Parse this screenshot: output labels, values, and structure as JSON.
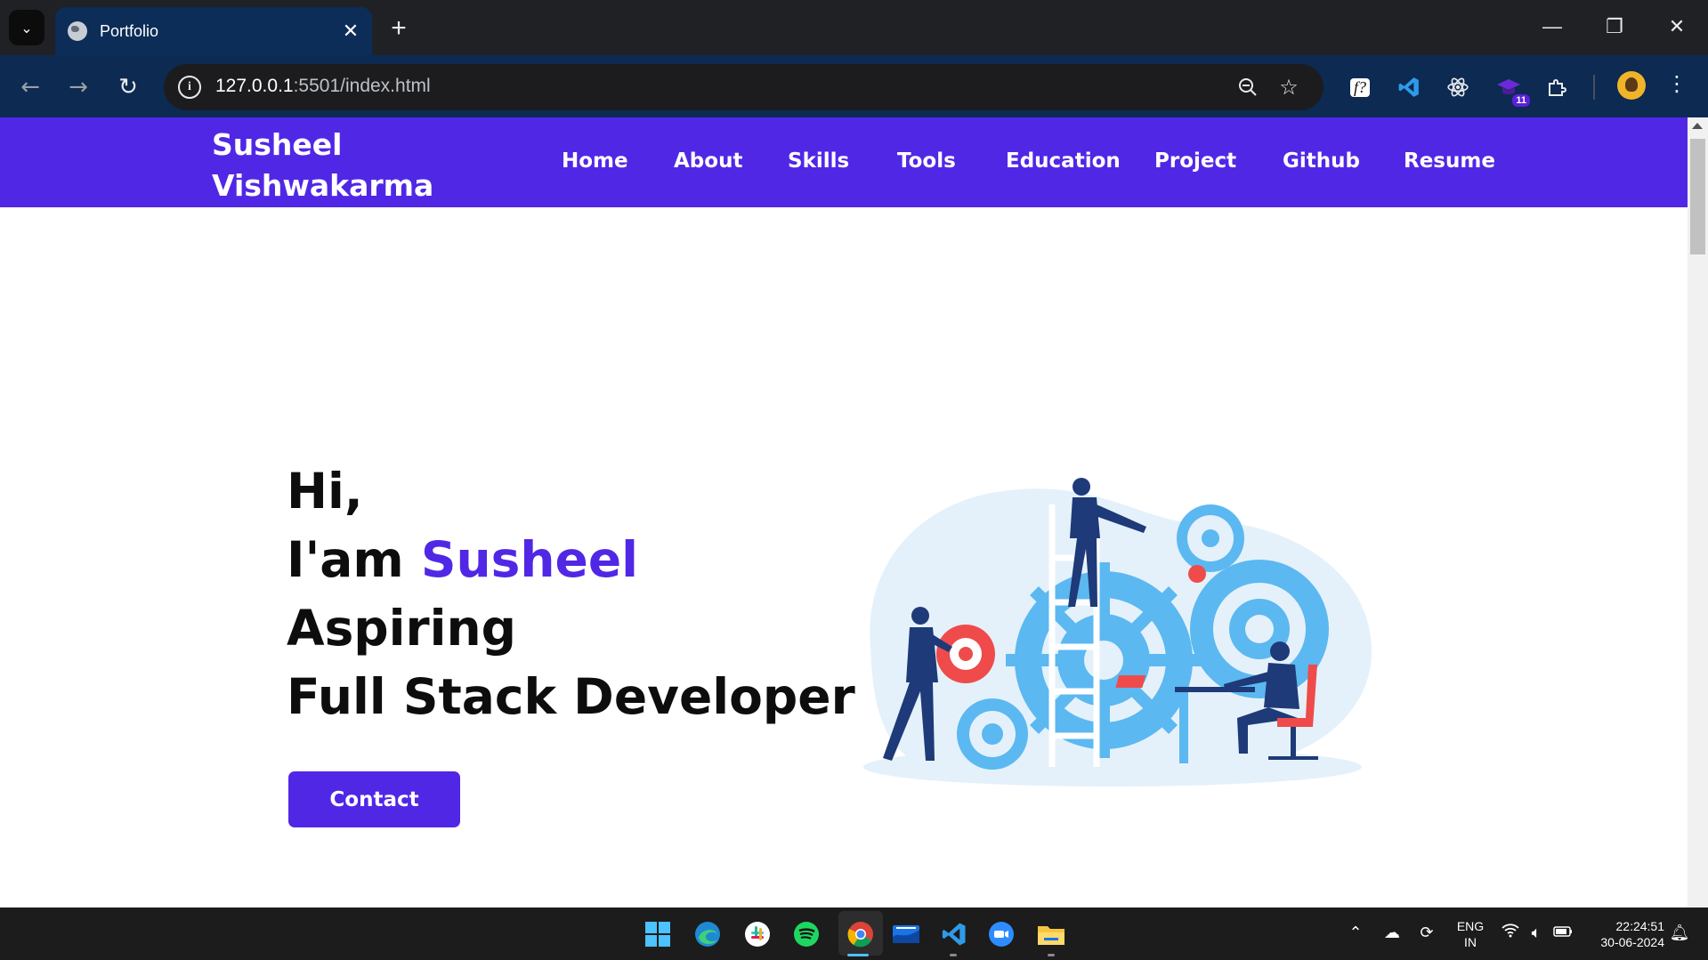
{
  "browser": {
    "tab_title": "Portfolio",
    "tab_close": "✕",
    "new_tab": "+",
    "url_host": "127.0.0.1",
    "url_rest": ":5501/index.html",
    "extension_badge": "11",
    "window_controls": {
      "minimize": "—",
      "restore": "❐",
      "close": "✕"
    }
  },
  "site": {
    "brand_line1": "Susheel",
    "brand_line2": "Vishwakarma",
    "accent_color": "#5127e6",
    "menu": [
      "Home",
      "About",
      "Skills",
      "Tools",
      "Education",
      "Project",
      "Github",
      "Resume"
    ]
  },
  "hero": {
    "line1": "Hi,",
    "line2_prefix": "I'am ",
    "line2_name": "Susheel",
    "line3": "Aspiring",
    "line4": "Full Stack Developer",
    "contact_label": "Contact"
  },
  "taskbar": {
    "lang_line1": "ENG",
    "lang_line2": "IN",
    "time": "22:24:51",
    "date": "30-06-2024",
    "apps": [
      "windows-start",
      "edge",
      "slack",
      "spotify",
      "chrome",
      "mail",
      "vscode",
      "zoom",
      "file-explorer"
    ]
  }
}
